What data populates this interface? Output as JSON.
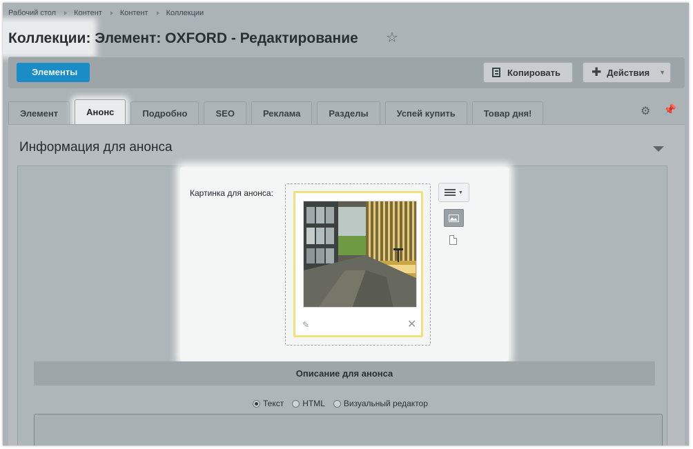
{
  "breadcrumb": [
    "Рабочий стол",
    "Контент",
    "Контент",
    "Коллекции"
  ],
  "title": "Коллекции: Элемент: OXFORD - Редактирование",
  "toolbar": {
    "elements_label": "Элементы",
    "copy_label": "Копировать",
    "actions_label": "Действия"
  },
  "tabs": [
    "Элемент",
    "Анонс",
    "Подробно",
    "SEO",
    "Реклама",
    "Разделы",
    "Успей купить",
    "Товар дня!"
  ],
  "active_tab": "Анонс",
  "section": {
    "heading": "Информация для анонса",
    "picture_label": "Картинка для анонса:",
    "description_header": "Описание для анонса",
    "format_options": [
      "Текст",
      "HTML",
      "Визуальный редактор"
    ],
    "format_selected": "Текст"
  },
  "icons": {
    "star": "star-icon",
    "gear": "gear-icon",
    "pin": "pin-icon",
    "edit": "pencil-icon",
    "delete": "close-icon",
    "menu": "menu-icon",
    "image_mode": "image-icon",
    "file_mode": "file-icon"
  },
  "colors": {
    "accent": "#1a8cc6",
    "highlight_border": "#f0e27a"
  }
}
